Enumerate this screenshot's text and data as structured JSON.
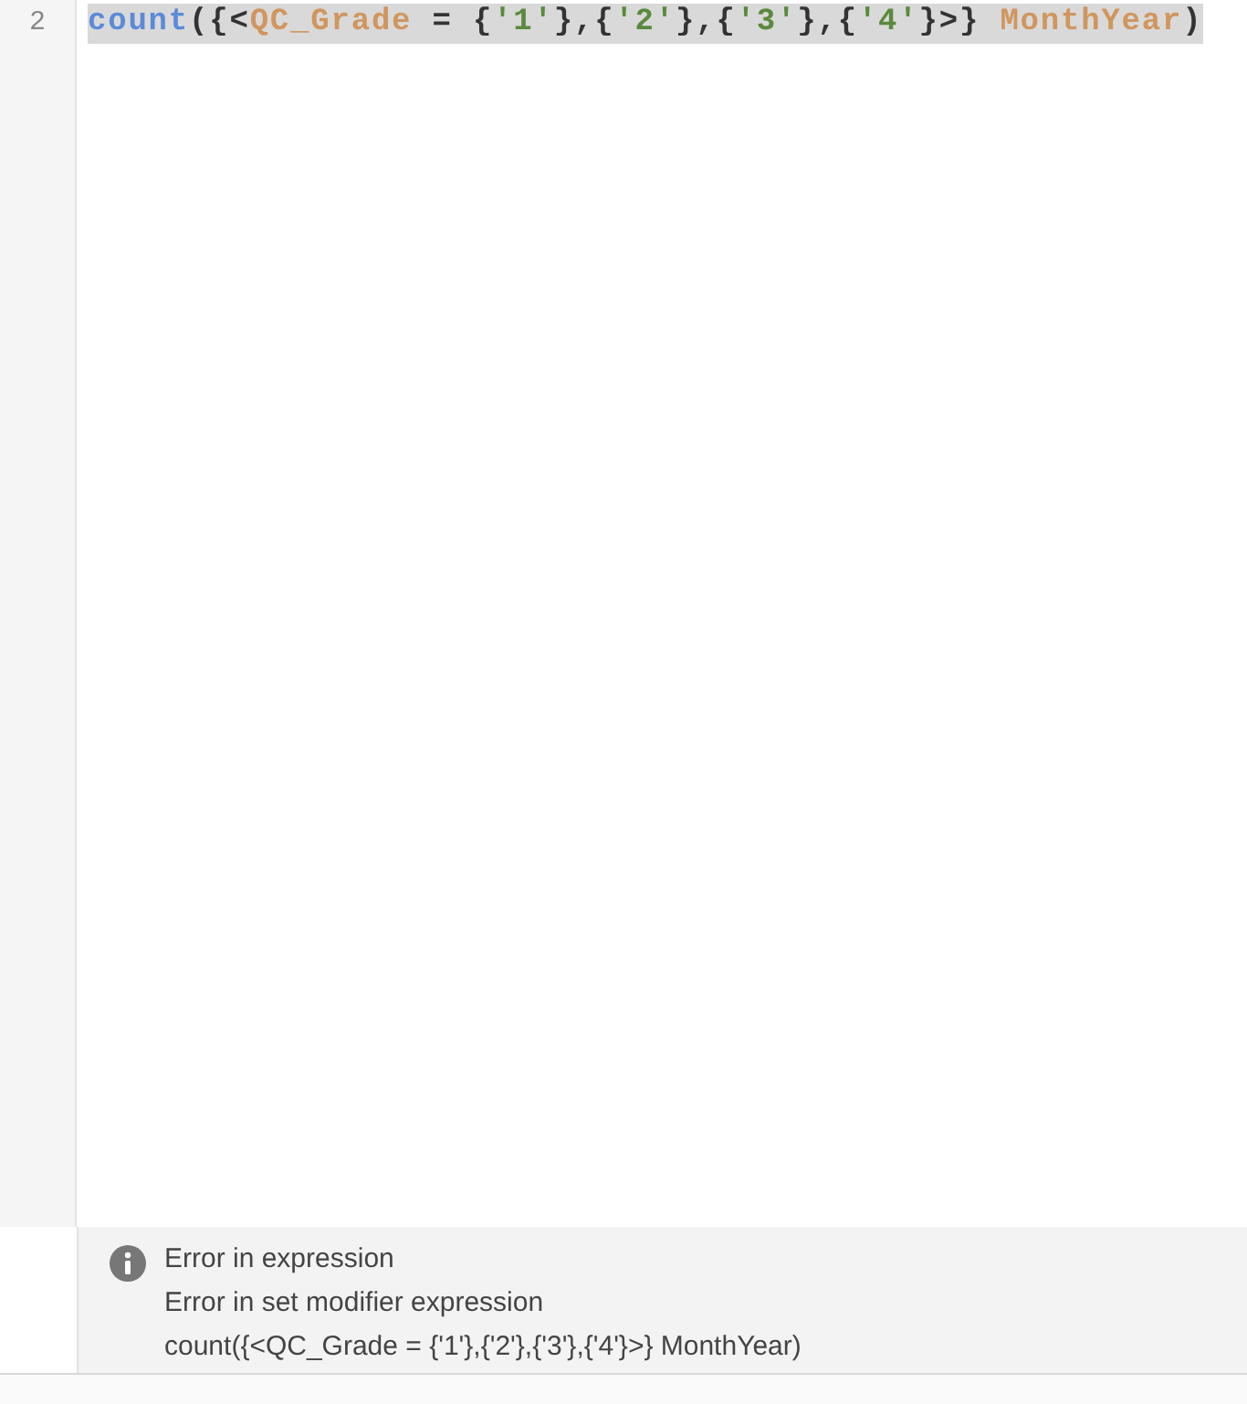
{
  "editor": {
    "line_number": "2",
    "line_selected": true,
    "tokens": [
      {
        "kind": "function",
        "text": "count"
      },
      {
        "kind": "punct",
        "text": "({<"
      },
      {
        "kind": "field",
        "text": "QC_Grade"
      },
      {
        "kind": "punct",
        "text": " = {"
      },
      {
        "kind": "string",
        "text": "'1'"
      },
      {
        "kind": "punct",
        "text": "},{"
      },
      {
        "kind": "string",
        "text": "'2'"
      },
      {
        "kind": "punct",
        "text": "},{"
      },
      {
        "kind": "string",
        "text": "'3'"
      },
      {
        "kind": "punct",
        "text": "},{"
      },
      {
        "kind": "string",
        "text": "'4'"
      },
      {
        "kind": "punct",
        "text": "}>} "
      },
      {
        "kind": "field",
        "text": "MonthYear"
      },
      {
        "kind": "punct",
        "text": ")"
      }
    ]
  },
  "error_panel": {
    "messages": [
      "Error in expression",
      "Error in set modifier expression",
      "count({<QC_Grade = {'1'},{'2'},{'3'},{'4'}>} MonthYear)"
    ]
  }
}
